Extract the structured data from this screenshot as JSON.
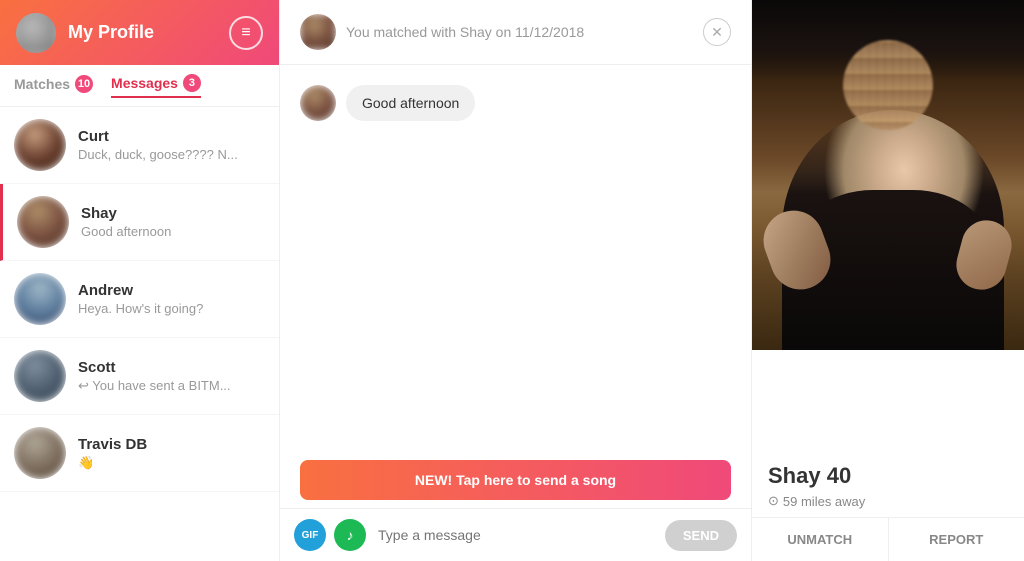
{
  "sidebar": {
    "profile_title": "My Profile",
    "profile_icon": "☰",
    "tabs": [
      {
        "id": "matches",
        "label": "Matches",
        "badge": "10",
        "active": false
      },
      {
        "id": "messages",
        "label": "Messages",
        "badge": "3",
        "active": true
      }
    ],
    "matches": [
      {
        "id": "curt",
        "name": "Curt",
        "preview": "Duck, duck, goose???? N...",
        "avatar_class": "avatar-curt",
        "active": false
      },
      {
        "id": "shay",
        "name": "Shay",
        "preview": "Good afternoon",
        "avatar_class": "avatar-shay",
        "active": true
      },
      {
        "id": "andrew",
        "name": "Andrew",
        "preview": "Heya. How's it going?",
        "avatar_class": "avatar-andrew",
        "active": false
      },
      {
        "id": "scott",
        "name": "Scott",
        "preview": "↩ You have sent a BITM...",
        "avatar_class": "avatar-scott",
        "active": false
      },
      {
        "id": "travis",
        "name": "Travis DB",
        "preview": "👋",
        "avatar_class": "avatar-travis",
        "active": false
      }
    ]
  },
  "chat": {
    "match_info": "You matched with Shay on 11/12/2018",
    "close_label": "✕",
    "messages": [
      {
        "sender": "shay",
        "text": "Good afternoon"
      }
    ],
    "song_banner": "NEW! Tap here to send a song",
    "input_placeholder": "Type a message",
    "gif_label": "GIF",
    "music_icon": "♪",
    "send_label": "SEND"
  },
  "profile": {
    "name": "Shay",
    "age": "40",
    "distance": "59 miles away",
    "location_icon": "⊙",
    "unmatch_label": "UNMATCH",
    "report_label": "REPORT"
  }
}
